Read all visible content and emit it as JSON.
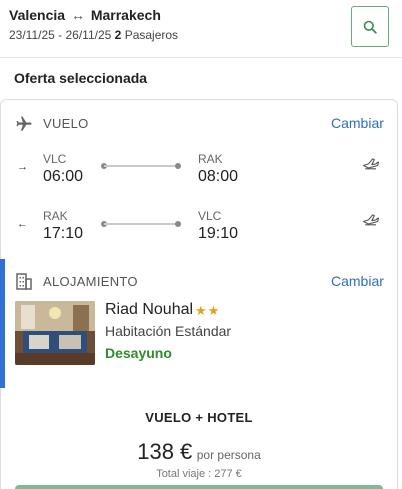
{
  "header": {
    "origin": "Valencia",
    "route_arrow": "↔",
    "destination": "Marrakech",
    "dates": "23/11/25 - 26/11/25",
    "passenger_count": "2",
    "passenger_label": "Pasajeros",
    "search_icon": "search-icon"
  },
  "offer": {
    "title": "Oferta seleccionada"
  },
  "flight": {
    "label": "VUELO",
    "change_label": "Cambiar",
    "outbound": {
      "direction_glyph": "→",
      "from_code": "VLC",
      "from_time": "06:00",
      "to_code": "RAK",
      "to_time": "08:00"
    },
    "return": {
      "direction_glyph": "←",
      "from_code": "RAK",
      "from_time": "17:10",
      "to_code": "VLC",
      "to_time": "19:10"
    }
  },
  "hotel": {
    "label": "ALOJAMIENTO",
    "change_label": "Cambiar",
    "name": "Riad Nouhal",
    "stars": 2,
    "stars_text": "★★",
    "room": "Habitación Estándar",
    "board": "Desayuno"
  },
  "package": {
    "title": "VUELO + HOTEL",
    "price": "138 €",
    "price_suffix": "por persona",
    "total": "Total viaje : 277 €"
  },
  "colors": {
    "accent_blue": "#2f6fd6",
    "link_blue": "#2f6fb6",
    "board_green": "#2e8b2e",
    "star_gold": "#e0a21b",
    "cta_green": "#7dbb93"
  }
}
